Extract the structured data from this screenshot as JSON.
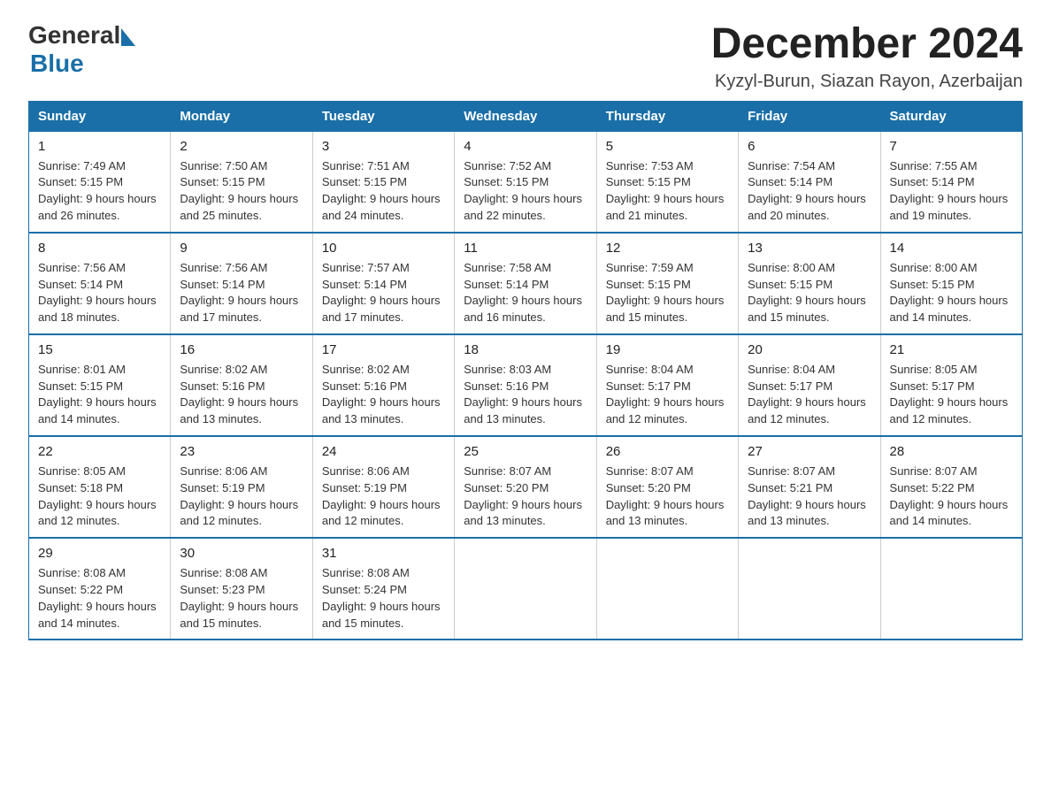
{
  "logo": {
    "general": "General",
    "blue": "Blue"
  },
  "title": "December 2024",
  "subtitle": "Kyzyl-Burun, Siazan Rayon, Azerbaijan",
  "days_of_week": [
    "Sunday",
    "Monday",
    "Tuesday",
    "Wednesday",
    "Thursday",
    "Friday",
    "Saturday"
  ],
  "weeks": [
    [
      {
        "day": "1",
        "sunrise": "7:49 AM",
        "sunset": "5:15 PM",
        "daylight": "9 hours and 26 minutes."
      },
      {
        "day": "2",
        "sunrise": "7:50 AM",
        "sunset": "5:15 PM",
        "daylight": "9 hours and 25 minutes."
      },
      {
        "day": "3",
        "sunrise": "7:51 AM",
        "sunset": "5:15 PM",
        "daylight": "9 hours and 24 minutes."
      },
      {
        "day": "4",
        "sunrise": "7:52 AM",
        "sunset": "5:15 PM",
        "daylight": "9 hours and 22 minutes."
      },
      {
        "day": "5",
        "sunrise": "7:53 AM",
        "sunset": "5:15 PM",
        "daylight": "9 hours and 21 minutes."
      },
      {
        "day": "6",
        "sunrise": "7:54 AM",
        "sunset": "5:14 PM",
        "daylight": "9 hours and 20 minutes."
      },
      {
        "day": "7",
        "sunrise": "7:55 AM",
        "sunset": "5:14 PM",
        "daylight": "9 hours and 19 minutes."
      }
    ],
    [
      {
        "day": "8",
        "sunrise": "7:56 AM",
        "sunset": "5:14 PM",
        "daylight": "9 hours and 18 minutes."
      },
      {
        "day": "9",
        "sunrise": "7:56 AM",
        "sunset": "5:14 PM",
        "daylight": "9 hours and 17 minutes."
      },
      {
        "day": "10",
        "sunrise": "7:57 AM",
        "sunset": "5:14 PM",
        "daylight": "9 hours and 17 minutes."
      },
      {
        "day": "11",
        "sunrise": "7:58 AM",
        "sunset": "5:14 PM",
        "daylight": "9 hours and 16 minutes."
      },
      {
        "day": "12",
        "sunrise": "7:59 AM",
        "sunset": "5:15 PM",
        "daylight": "9 hours and 15 minutes."
      },
      {
        "day": "13",
        "sunrise": "8:00 AM",
        "sunset": "5:15 PM",
        "daylight": "9 hours and 15 minutes."
      },
      {
        "day": "14",
        "sunrise": "8:00 AM",
        "sunset": "5:15 PM",
        "daylight": "9 hours and 14 minutes."
      }
    ],
    [
      {
        "day": "15",
        "sunrise": "8:01 AM",
        "sunset": "5:15 PM",
        "daylight": "9 hours and 14 minutes."
      },
      {
        "day": "16",
        "sunrise": "8:02 AM",
        "sunset": "5:16 PM",
        "daylight": "9 hours and 13 minutes."
      },
      {
        "day": "17",
        "sunrise": "8:02 AM",
        "sunset": "5:16 PM",
        "daylight": "9 hours and 13 minutes."
      },
      {
        "day": "18",
        "sunrise": "8:03 AM",
        "sunset": "5:16 PM",
        "daylight": "9 hours and 13 minutes."
      },
      {
        "day": "19",
        "sunrise": "8:04 AM",
        "sunset": "5:17 PM",
        "daylight": "9 hours and 12 minutes."
      },
      {
        "day": "20",
        "sunrise": "8:04 AM",
        "sunset": "5:17 PM",
        "daylight": "9 hours and 12 minutes."
      },
      {
        "day": "21",
        "sunrise": "8:05 AM",
        "sunset": "5:17 PM",
        "daylight": "9 hours and 12 minutes."
      }
    ],
    [
      {
        "day": "22",
        "sunrise": "8:05 AM",
        "sunset": "5:18 PM",
        "daylight": "9 hours and 12 minutes."
      },
      {
        "day": "23",
        "sunrise": "8:06 AM",
        "sunset": "5:19 PM",
        "daylight": "9 hours and 12 minutes."
      },
      {
        "day": "24",
        "sunrise": "8:06 AM",
        "sunset": "5:19 PM",
        "daylight": "9 hours and 12 minutes."
      },
      {
        "day": "25",
        "sunrise": "8:07 AM",
        "sunset": "5:20 PM",
        "daylight": "9 hours and 13 minutes."
      },
      {
        "day": "26",
        "sunrise": "8:07 AM",
        "sunset": "5:20 PM",
        "daylight": "9 hours and 13 minutes."
      },
      {
        "day": "27",
        "sunrise": "8:07 AM",
        "sunset": "5:21 PM",
        "daylight": "9 hours and 13 minutes."
      },
      {
        "day": "28",
        "sunrise": "8:07 AM",
        "sunset": "5:22 PM",
        "daylight": "9 hours and 14 minutes."
      }
    ],
    [
      {
        "day": "29",
        "sunrise": "8:08 AM",
        "sunset": "5:22 PM",
        "daylight": "9 hours and 14 minutes."
      },
      {
        "day": "30",
        "sunrise": "8:08 AM",
        "sunset": "5:23 PM",
        "daylight": "9 hours and 15 minutes."
      },
      {
        "day": "31",
        "sunrise": "8:08 AM",
        "sunset": "5:24 PM",
        "daylight": "9 hours and 15 minutes."
      },
      null,
      null,
      null,
      null
    ]
  ]
}
